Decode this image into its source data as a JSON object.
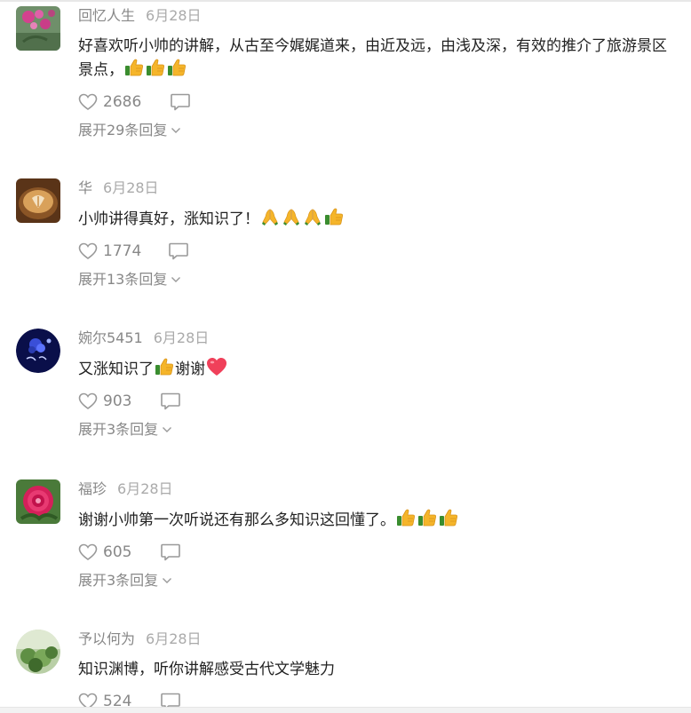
{
  "colors": {
    "text": "#222222",
    "muted": "#888888",
    "icon": "#999999"
  },
  "comments": [
    {
      "author": "回忆人生",
      "date": "6月28日",
      "text_line1": "好喜欢听小帅的讲解，从古至今娓娓道来，由近及远，由浅及深，有效的推介了旅游景区",
      "text_line2": "景点，",
      "emojis": [
        "thumbs-up",
        "thumbs-up",
        "thumbs-up"
      ],
      "likes": "2686",
      "expand": "展开29条回复"
    },
    {
      "author": "华",
      "date": "6月28日",
      "text": "小帅讲得真好，涨知识了！",
      "emojis": [
        "pray",
        "pray",
        "pray",
        "thumbs-up"
      ],
      "likes": "1774",
      "expand": "展开13条回复"
    },
    {
      "author": "婉尔5451",
      "date": "6月28日",
      "text_before": "又涨知识了",
      "text_after": "谢谢",
      "likes": "903",
      "expand": "展开3条回复"
    },
    {
      "author": "福珍",
      "date": "6月28日",
      "text": "谢谢小帅第一次听说还有那么多知识这回懂了。",
      "emojis": [
        "thumbs-up",
        "thumbs-up",
        "thumbs-up"
      ],
      "likes": "605",
      "expand": "展开3条回复"
    },
    {
      "author": "予以何为",
      "date": "6月28日",
      "text": "知识渊博，听你讲解感受古代文学魅力",
      "likes": "524"
    }
  ]
}
